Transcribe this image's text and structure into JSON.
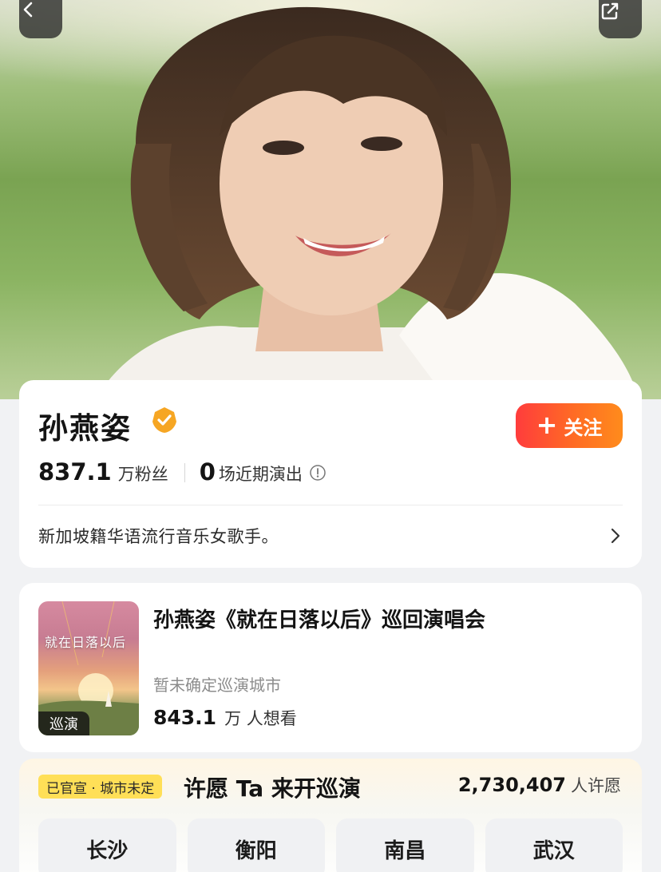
{
  "nav": {
    "back_icon": "chevron-left-icon",
    "share_icon": "share-icon"
  },
  "profile": {
    "name": "孙燕姿",
    "verified_icon": "verified-check-icon",
    "follow_label": "关注",
    "follow_plus": "+",
    "fans_count": "837.1",
    "fans_label": "万粉丝",
    "shows_count": "0",
    "shows_label": "场近期演出",
    "info_icon": "info-circle-icon",
    "bio": "新加坡籍华语流行音乐女歌手。",
    "bio_chevron": "chevron-right-icon"
  },
  "concert": {
    "poster_title": "就在日落以后",
    "poster_tag": "巡演",
    "title": "孙燕姿《就在日落以后》巡回演唱会",
    "city_status": "暂未确定巡演城市",
    "want_count": "843.1",
    "want_label": "万 人想看"
  },
  "wish": {
    "badge": "已官宣 · 城市未定",
    "title": "许愿 Ta 来开巡演",
    "count": "2,730,407",
    "count_label": "人许愿",
    "cities": [
      "长沙",
      "衡阳",
      "南昌",
      "武汉"
    ]
  },
  "colors": {
    "follow_gradient_start": "#ff3c3c",
    "follow_gradient_end": "#ff8b1c",
    "badge_yellow": "#ffdf57",
    "verified_orange": "#f6a623"
  }
}
